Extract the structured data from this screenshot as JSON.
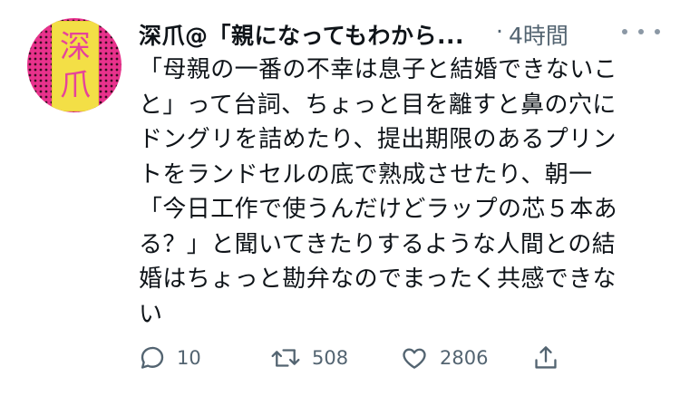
{
  "tweet": {
    "author_name": "深爪@「親になってもわから...",
    "separator": "·",
    "time": "4時間",
    "avatar": {
      "glyph_top": "深",
      "glyph_bottom": "爪",
      "colors": {
        "background": "#e8328c",
        "dots": "#3a0d22",
        "panel": "#f3df46",
        "glyph": "#e6439a"
      }
    },
    "text_lines": [
      "「母親の一番の不幸は息子と結婚できないこ",
      "と」って台詞、ちょっと目を離すと鼻の穴に",
      "ドングリを詰めたり、提出期限のあるプリン",
      "トをランドセルの底で熟成させたり、朝一",
      "「今日工作で使うんだけどラップの芯５本あ",
      "る？」と聞いてきたりするような人間との結",
      "婚はちょっと勘弁なのでまったく共感できな",
      "い"
    ],
    "actions": {
      "reply": {
        "icon": "reply-icon",
        "count": "10"
      },
      "retweet": {
        "icon": "retweet-icon",
        "count": "508"
      },
      "like": {
        "icon": "heart-icon",
        "count": "2806"
      },
      "share": {
        "icon": "share-icon"
      }
    }
  },
  "colors": {
    "text": "#0f1419",
    "secondary": "#536471",
    "more_dots": "#8b98a5"
  }
}
